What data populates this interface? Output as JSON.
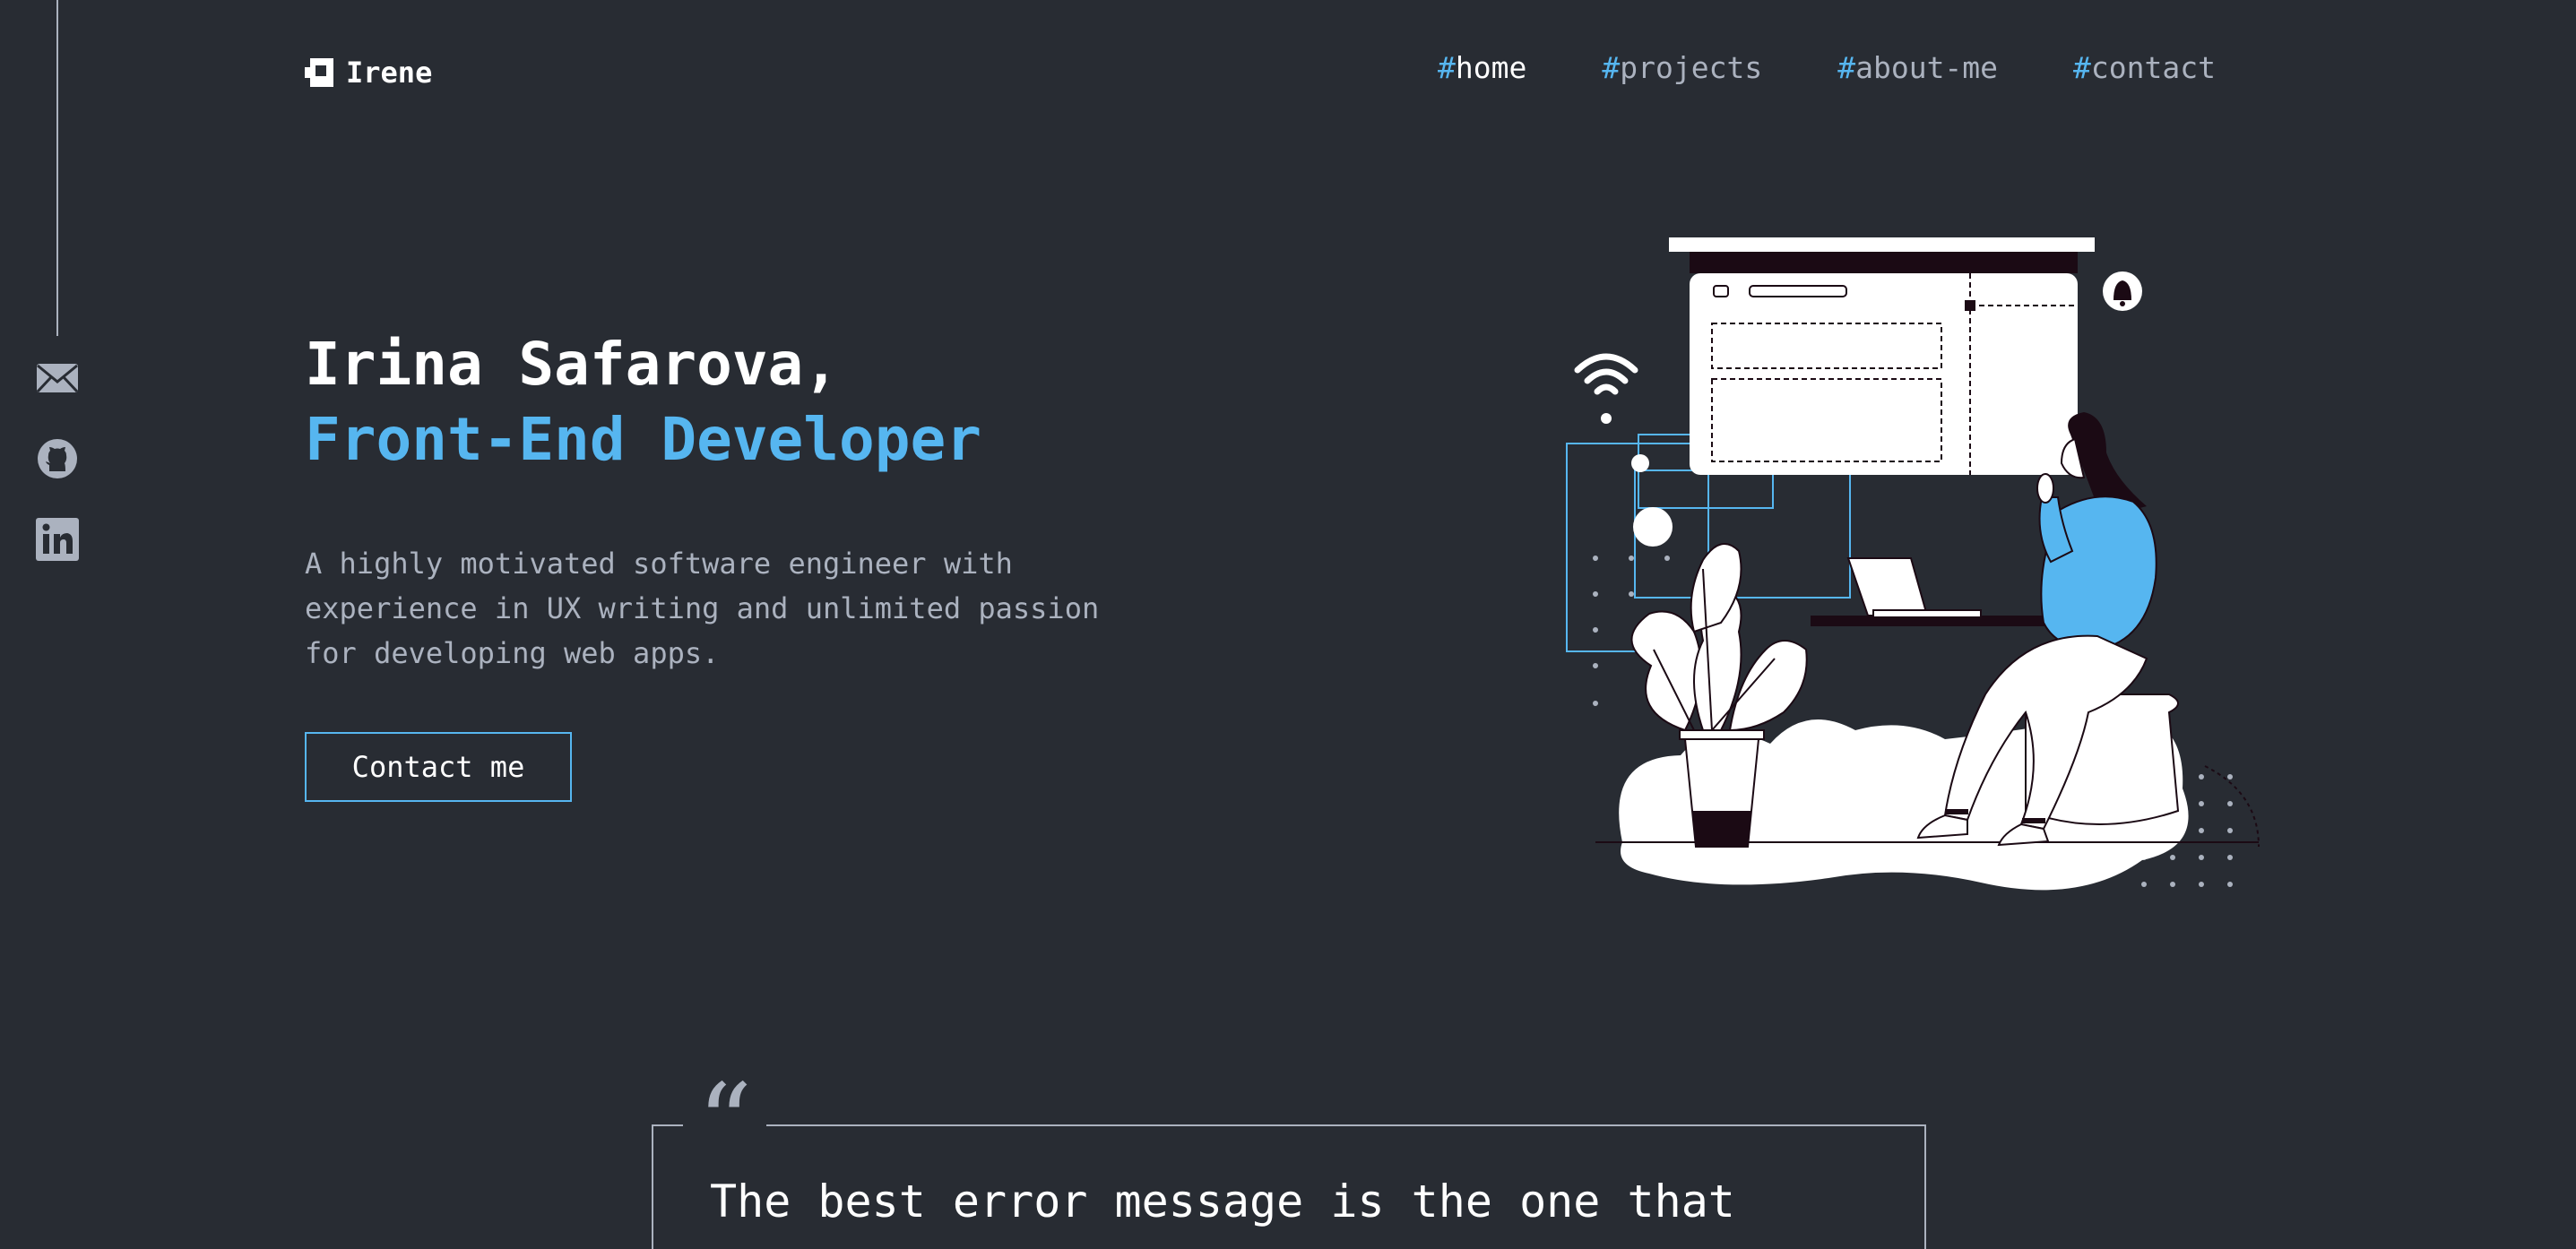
{
  "header": {
    "logo_text": "Irene",
    "nav": [
      {
        "hash": "#",
        "label": "home",
        "active": true
      },
      {
        "hash": "#",
        "label": "projects",
        "active": false
      },
      {
        "hash": "#",
        "label": "about-me",
        "active": false
      },
      {
        "hash": "#",
        "label": "contact",
        "active": false
      }
    ]
  },
  "social": [
    {
      "icon": "mail-icon"
    },
    {
      "icon": "github-icon"
    },
    {
      "icon": "linkedin-icon"
    }
  ],
  "hero": {
    "name_line": "Irina Safarova,",
    "role_line": "Front-End Developer",
    "description_lines": [
      "A highly motivated software engineer with",
      "experience in UX writing and unlimited passion",
      "for developing web apps."
    ],
    "cta_label": "Contact me"
  },
  "quote": {
    "mark": "“",
    "text": "The best error message is the one that"
  },
  "colors": {
    "background": "#282c33",
    "accent": "#56b6f0",
    "muted_text": "#abb2bf",
    "text": "#ffffff"
  }
}
